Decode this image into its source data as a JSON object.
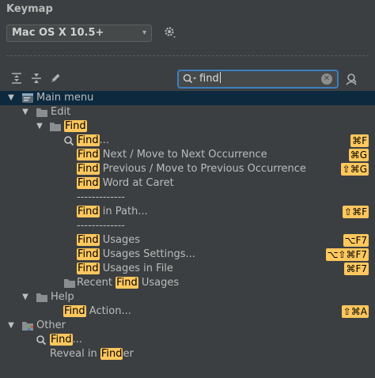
{
  "title": "Keymap",
  "keymap_select": {
    "value": "Mac OS X 10.5+",
    "arrow": "▾"
  },
  "search": {
    "value": "find"
  },
  "colors": {
    "highlight": "#ffc75d",
    "selection": "#0d293e",
    "focus_border": "#3d7fc1",
    "background": "#3c3f41"
  },
  "icons": [
    "gear-icon",
    "expand-all-icon",
    "collapse-all-icon",
    "edit-pencil-icon",
    "search-icon",
    "clear-icon",
    "find-usages-icon",
    "folder-icon",
    "menu-icon",
    "other-icon",
    "magnifier-icon"
  ],
  "tree": {
    "main_menu": "Main menu",
    "edit": "Edit",
    "find_folder": "Find",
    "find": {
      "hl": "Find",
      "rest": "...",
      "shortcut": "⌘F"
    },
    "find_next": {
      "hl": "Find",
      "rest": " Next / Move to Next Occurrence",
      "shortcut": "⌘G"
    },
    "find_prev": {
      "hl": "Find",
      "rest": " Previous / Move to Previous Occurrence",
      "shortcut": "⇧⌘G"
    },
    "find_word": {
      "hl": "Find",
      "rest": " Word at Caret"
    },
    "sep1": "-------------",
    "find_in_path": {
      "hl": "Find",
      "rest": " in Path...",
      "shortcut": "⇧⌘F"
    },
    "sep2": "-------------",
    "find_usages": {
      "hl": "Find",
      "rest": " Usages",
      "shortcut": "⌥F7"
    },
    "find_usages_settings": {
      "hl": "Find",
      "rest": " Usages Settings...",
      "shortcut": "⌥⇧⌘F7"
    },
    "find_usages_in_file": {
      "hl": "Find",
      "rest": " Usages in File",
      "shortcut": "⌘F7"
    },
    "recent_find_usages": {
      "pre": "Recent ",
      "hl": "Find",
      "rest": " Usages"
    },
    "help": "Help",
    "find_action": {
      "hl": "Find",
      "rest": " Action...",
      "shortcut": "⇧⌘A"
    },
    "other": "Other",
    "other_find": {
      "hl": "Find",
      "rest": "..."
    },
    "reveal_in_finder": {
      "pre": "Reveal in ",
      "hl": "Find",
      "rest": "er"
    }
  }
}
